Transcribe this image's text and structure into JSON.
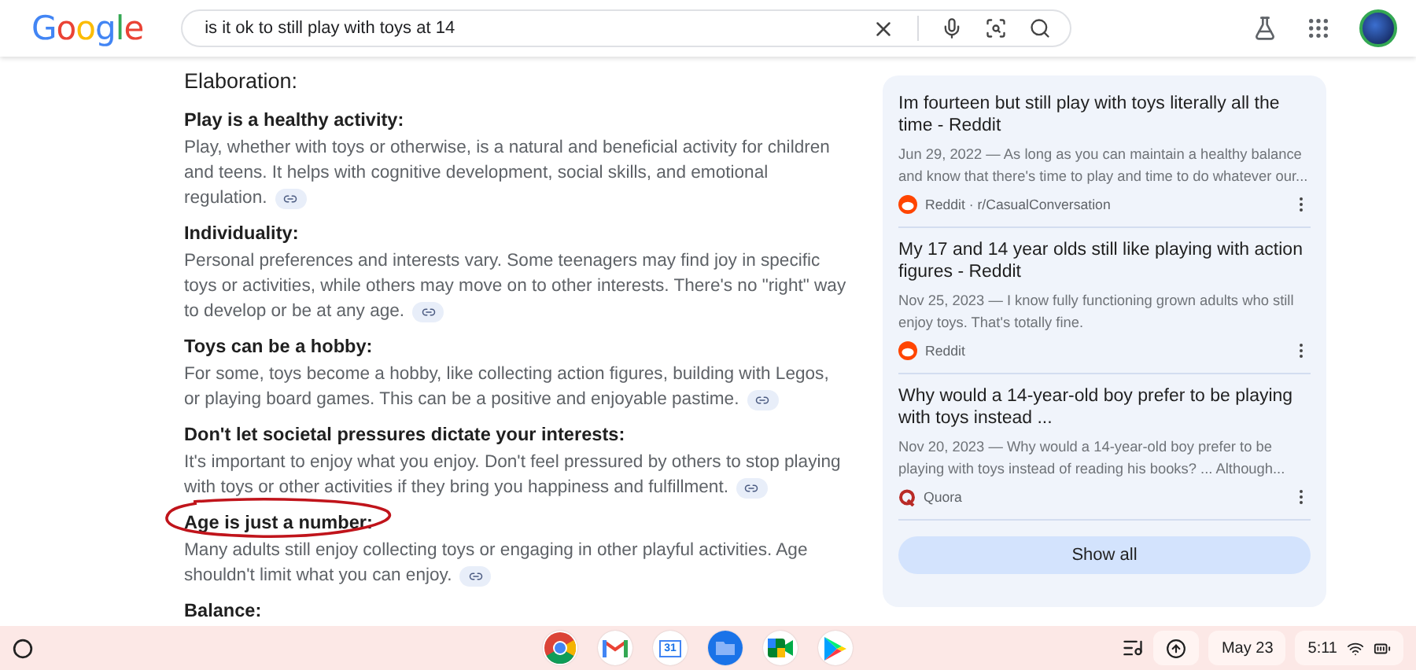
{
  "header": {
    "logo": "Google",
    "query": "is it ok to still play with toys at 14"
  },
  "overview": {
    "title": "Elaboration:",
    "sections": [
      {
        "heading": "Play is a healthy activity:",
        "body": "Play, whether with toys or otherwise, is a natural and beneficial activity for children and teens. It helps with cognitive development, social skills, and emotional regulation.",
        "circled": false
      },
      {
        "heading": "Individuality:",
        "body": "Personal preferences and interests vary. Some teenagers may find joy in specific toys or activities, while others may move on to other interests. There's no \"right\" way to develop or be at any age.",
        "circled": false
      },
      {
        "heading": "Toys can be a hobby:",
        "body": "For some, toys become a hobby, like collecting action figures, building with Legos, or playing board games. This can be a positive and enjoyable pastime.",
        "circled": false
      },
      {
        "heading": "Don't let societal pressures dictate your interests:",
        "body": "It's important to enjoy what you enjoy. Don't feel pressured by others to stop playing with toys or other activities if they bring you happiness and fulfillment.",
        "circled": false
      },
      {
        "heading": "Age is just a number:",
        "body": "Many adults still enjoy collecting toys or engaging in other playful activities. Age shouldn't limit what you can enjoy.",
        "circled": true
      },
      {
        "heading": "Balance:",
        "circled": false
      }
    ]
  },
  "sources": {
    "items": [
      {
        "title": "Im fourteen but still play with toys literally all the time - Reddit",
        "snippet": "Jun 29, 2022 — As long as you can maintain a healthy balance and know that there's time to play and time to do whatever our...",
        "site": "Reddit · r/CasualConversation",
        "kind": "reddit"
      },
      {
        "title": "My 17 and 14 year olds still like playing with action figures - Reddit",
        "snippet": "Nov 25, 2023 — I know fully functioning grown adults who still enjoy toys. That's totally fine.",
        "site": "Reddit",
        "kind": "reddit"
      },
      {
        "title": "Why would a 14-year-old boy prefer to be playing with toys instead ...",
        "snippet": "Nov 20, 2023 — Why would a 14-year-old boy prefer to be playing with toys instead of reading his books? ... Although...",
        "site": "Quora",
        "kind": "quora"
      }
    ],
    "button": "Show all"
  },
  "taskbar": {
    "apps": [
      {
        "kind": "chrome"
      },
      {
        "kind": "gmail"
      },
      {
        "kind": "calendar",
        "label": "31"
      },
      {
        "kind": "files"
      },
      {
        "kind": "meet"
      },
      {
        "kind": "play"
      }
    ],
    "date": "May 23",
    "time": "5:11"
  }
}
